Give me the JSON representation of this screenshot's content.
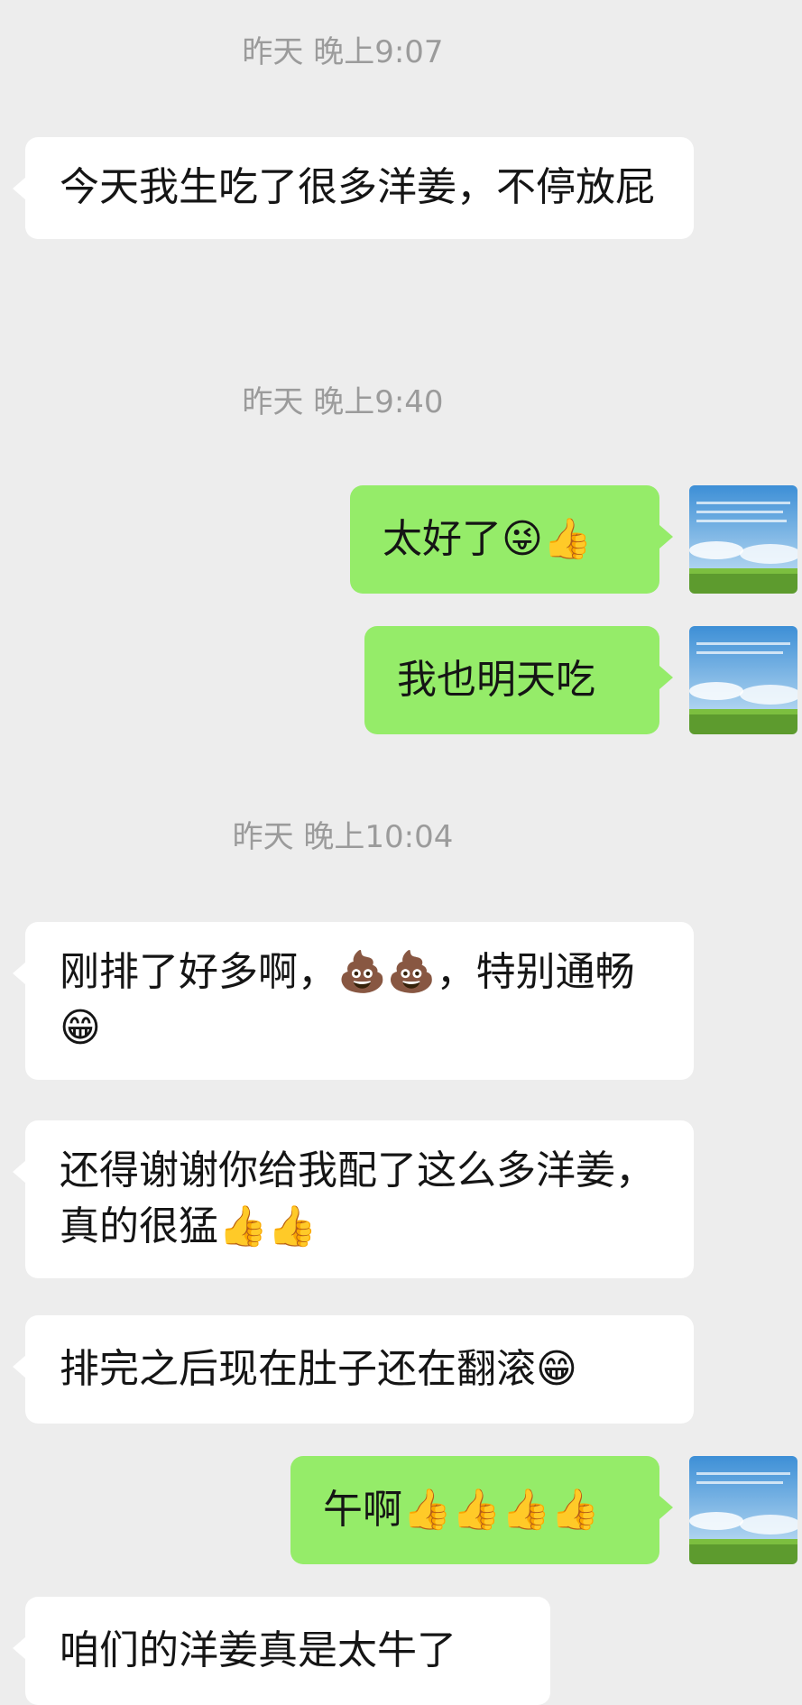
{
  "timestamps": [
    "昨天 晚上9:07",
    "昨天 晚上9:40",
    "昨天 晚上10:04"
  ],
  "messages": [
    {
      "side": "incoming",
      "text": "今天我生吃了很多洋姜，不停放屁"
    },
    {
      "side": "outgoing",
      "text": "太好了😜👍"
    },
    {
      "side": "outgoing",
      "text": "我也明天吃"
    },
    {
      "side": "incoming",
      "text": "刚排了好多啊，💩💩，特别通畅😁"
    },
    {
      "side": "incoming",
      "text": "还得谢谢你给我配了这么多洋姜，真的很猛👍👍"
    },
    {
      "side": "incoming",
      "text": "排完之后现在肚子还在翻滚😁"
    },
    {
      "side": "outgoing",
      "text": "午啊👍👍👍👍"
    },
    {
      "side": "incoming",
      "text": "咱们的洋姜真是太牛了"
    }
  ],
  "colors": {
    "background": "#ededed",
    "incoming_bubble": "#ffffff",
    "outgoing_bubble": "#95ec69",
    "timestamp_text": "#9b9b9b"
  },
  "icons": {
    "avatar": "sky-meadow-avatar-icon"
  }
}
